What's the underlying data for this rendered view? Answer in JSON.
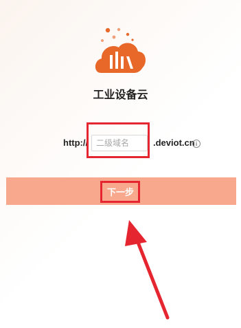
{
  "app": {
    "title": "工业设备云"
  },
  "url_form": {
    "prefix": "http://",
    "subdomain_placeholder": "二级域名",
    "subdomain_value": "",
    "suffix": ".deviot.cn",
    "info_icon": "info-icon"
  },
  "actions": {
    "next_label": "下一步"
  },
  "colors": {
    "brand_orange": "#e8682a",
    "button_bg": "#f8a98d",
    "annotation_red": "#e5252f"
  }
}
